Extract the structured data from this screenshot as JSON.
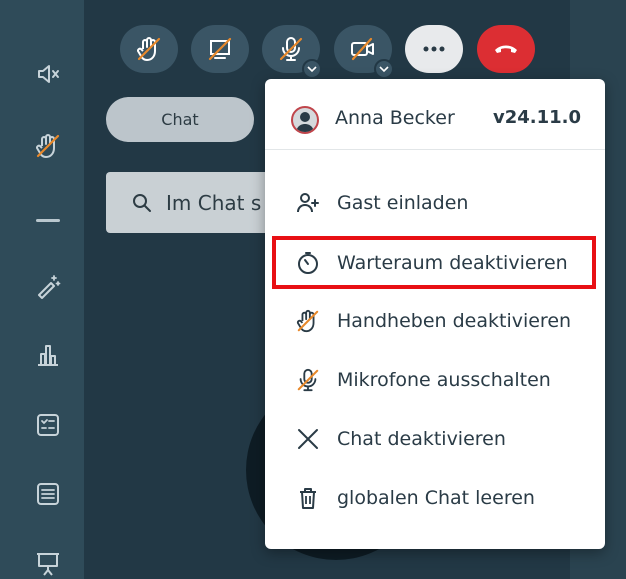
{
  "controls": {
    "raise_hand": "raise-hand-off-icon",
    "screen_share": "screen-share-off-icon",
    "microphone": "microphone-off-icon",
    "camera": "camera-off-icon",
    "more": "more-options-icon",
    "hangup": "hang-up-icon"
  },
  "sidebar": {
    "items": [
      "speaker-muted-icon",
      "raise-hand-off-icon",
      "magic-wand-icon",
      "poll-chart-icon",
      "checklist-icon",
      "notes-icon",
      "presentation-icon"
    ]
  },
  "chat": {
    "tab_label": "Chat",
    "search_placeholder": "Im Chat s"
  },
  "menu": {
    "user_name": "Anna Becker",
    "version": "v24.11.0",
    "items": [
      {
        "label": "Gast einladen",
        "icon": "add-user-icon"
      },
      {
        "label": "Warteraum deaktivieren",
        "icon": "timer-icon"
      },
      {
        "label": "Handheben deaktivieren",
        "icon": "raise-hand-off-icon"
      },
      {
        "label": "Mikrofone ausschalten",
        "icon": "microphone-off-icon"
      },
      {
        "label": "Chat deaktivieren",
        "icon": "close-icon"
      },
      {
        "label": "globalen Chat leeren",
        "icon": "trash-icon"
      }
    ]
  },
  "colors": {
    "accent_orange": "#e8892b",
    "hangup_red": "#dc2e33",
    "highlight_red": "#e80f14"
  }
}
